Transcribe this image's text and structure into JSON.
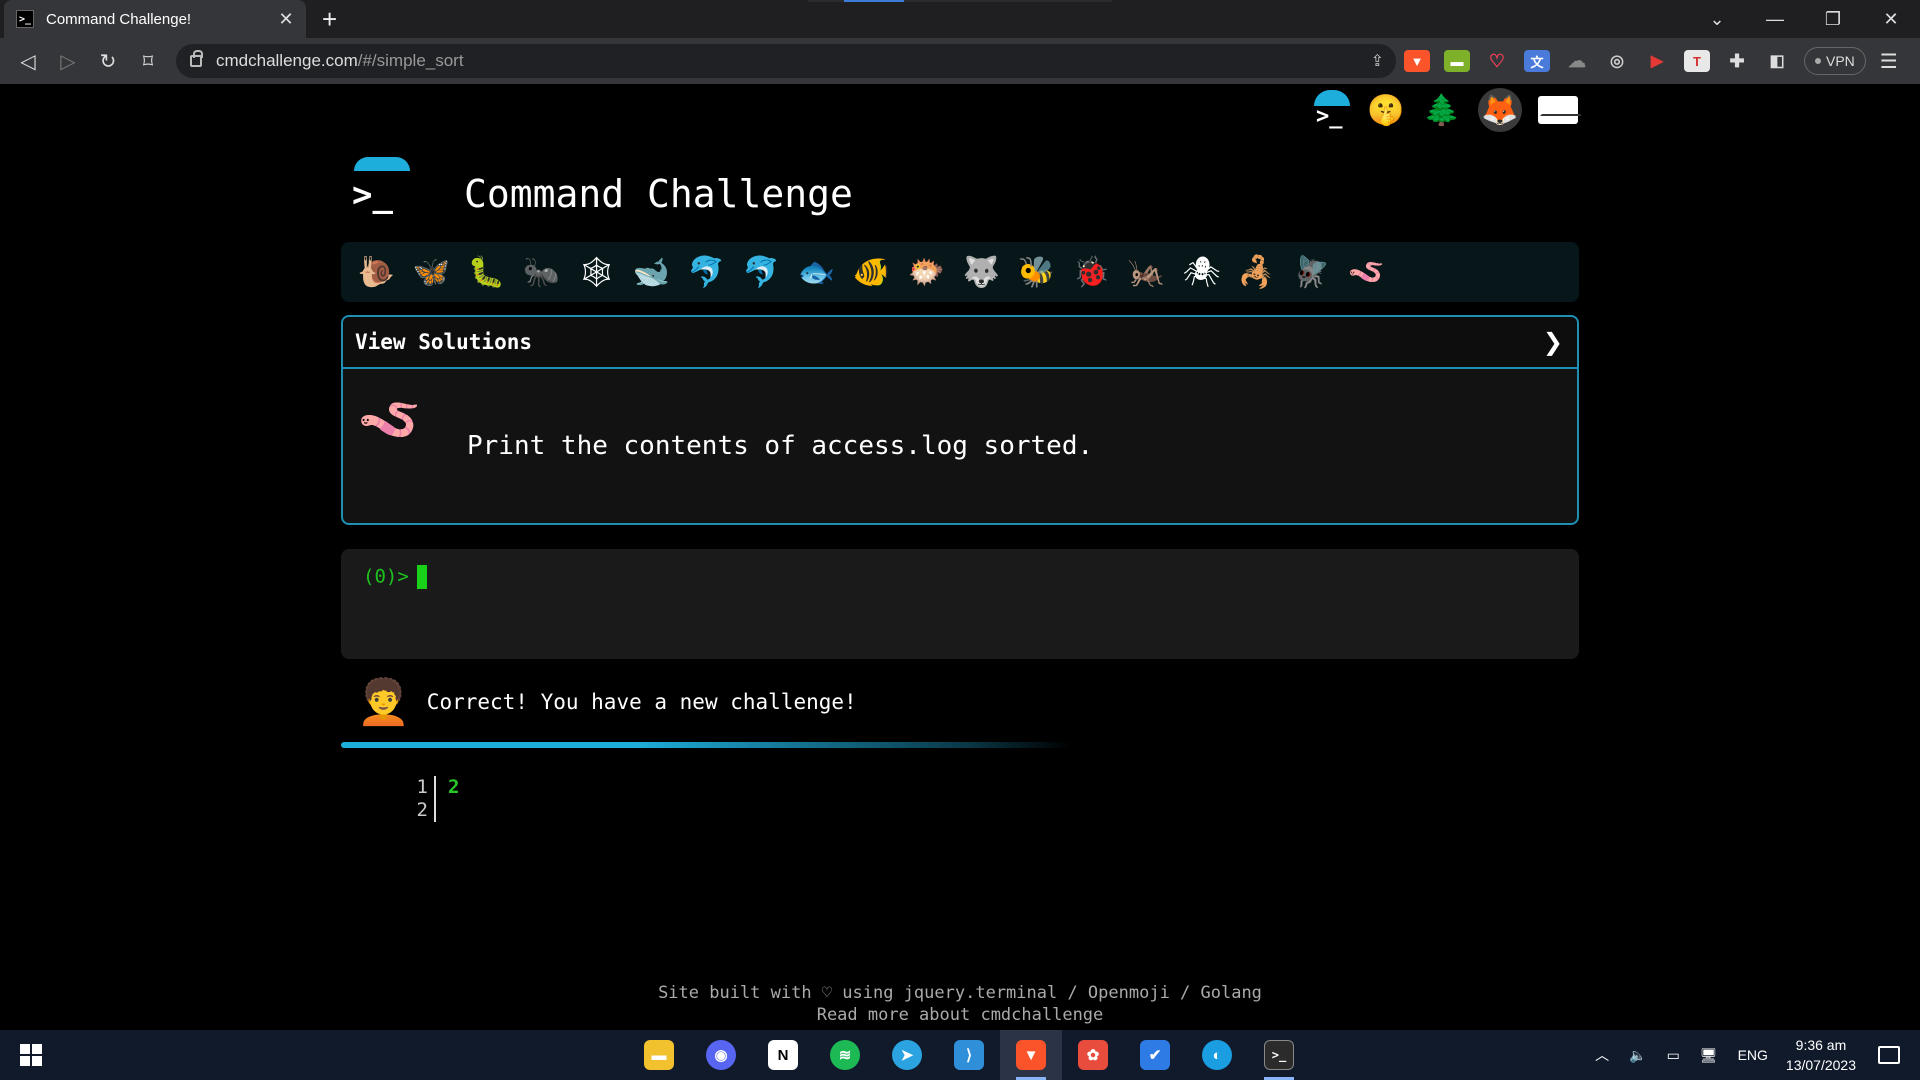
{
  "browser": {
    "tab_title": "Command Challenge!",
    "tab_favicon": ">_",
    "url_host": "cmdchallenge.com",
    "url_path": "/#/simple_sort",
    "vpn_label": "VPN"
  },
  "page": {
    "site_title": "Command Challenge",
    "logo_prompt": ">_",
    "creatures": [
      "🐌",
      "🦋",
      "🐛",
      "🐜",
      "🕸",
      "🐋",
      "🐬",
      "🐬",
      "🐟",
      "🐠",
      "🐡",
      "🐺",
      "🐝",
      "🐞",
      "🦗",
      "🕷",
      "🦂",
      "🪰",
      "🪱"
    ],
    "solutions_label": "View Solutions",
    "challenge_text": "Print the contents of access.log sorted.",
    "challenge_icon": "🪱",
    "prompt": "(0)>",
    "result_icon": "🧑‍🦱",
    "result_message": "Correct! You have a new challenge!",
    "output_line_numbers": "1\n2",
    "output_lines": "2",
    "footer_line1": "Site built with ♡ using jquery.terminal / Openmoji / Golang",
    "footer_line2": "Read more about cmdchallenge"
  },
  "taskbar": {
    "apps": [
      {
        "name": "file-explorer",
        "glyph": "▬",
        "color": "#f2c12e"
      },
      {
        "name": "discord",
        "glyph": "◉",
        "color": "#5865f2"
      },
      {
        "name": "notion",
        "glyph": "N",
        "color": "#ffffff"
      },
      {
        "name": "spotify",
        "glyph": "≋",
        "color": "#1db954"
      },
      {
        "name": "telegram",
        "glyph": "➤",
        "color": "#2aa3e0"
      },
      {
        "name": "vscode",
        "glyph": "⟩",
        "color": "#2f8fd8"
      },
      {
        "name": "brave",
        "glyph": "▼",
        "color": "#fb542b"
      },
      {
        "name": "app-red",
        "glyph": "✿",
        "color": "#e84c3d"
      },
      {
        "name": "todo",
        "glyph": "✔",
        "color": "#2f7be5"
      },
      {
        "name": "edge",
        "glyph": "◐",
        "color": "#1b9de2"
      },
      {
        "name": "terminal",
        "glyph": ">_",
        "color": "#444444"
      }
    ],
    "language": "ENG",
    "time": "9:36 am",
    "date": "13/07/2023"
  }
}
